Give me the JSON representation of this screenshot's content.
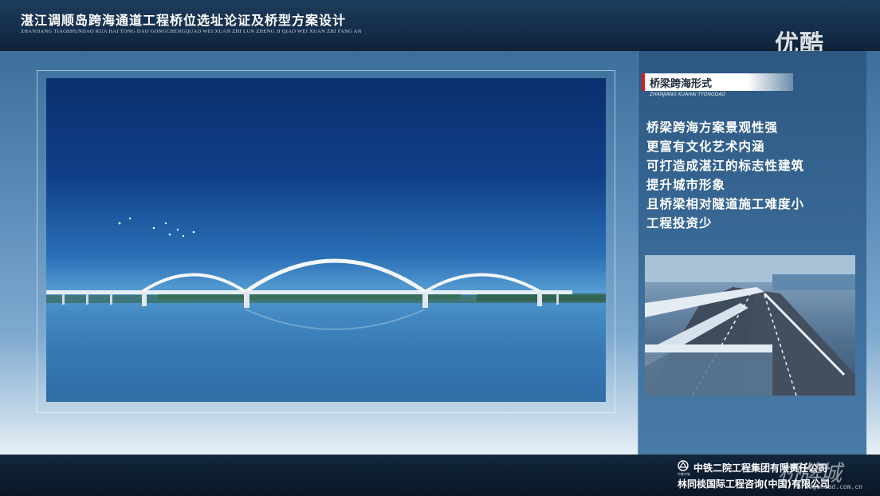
{
  "header": {
    "title": "湛江调顺岛跨海通道工程桥位选址论证及桥型方案设计",
    "pinyin": "ZHANJIANG TIAOSHUNDAO KUA HAI TONG DAO GONGCHENGQUAO WEI XUAN ZHI LUN ZHENG JI QIAO WEI XUAN ZHI FANG AN",
    "watermark_logo": "优酷"
  },
  "panel": {
    "section_title": "桥梁跨海形式",
    "section_subtitle": "ZHANJIANG KUAHAI TYONGDAO",
    "bullets": [
      "桥梁跨海方案景观性强",
      "更富有文化艺术内涵",
      "可打造成湛江的标志性建筑",
      "提升城市形象",
      "且桥梁相对隧道施工难度小",
      "工程投资少"
    ]
  },
  "footer": {
    "company_icon_label": "中铁中铁",
    "company_1": "中铁二院工程集团有限责任公司",
    "company_2": "林同棪国际工程咨询(中国)有限公司",
    "watermark_text": "桥牌城",
    "watermark_url": "Bridgehead.com.cn"
  }
}
